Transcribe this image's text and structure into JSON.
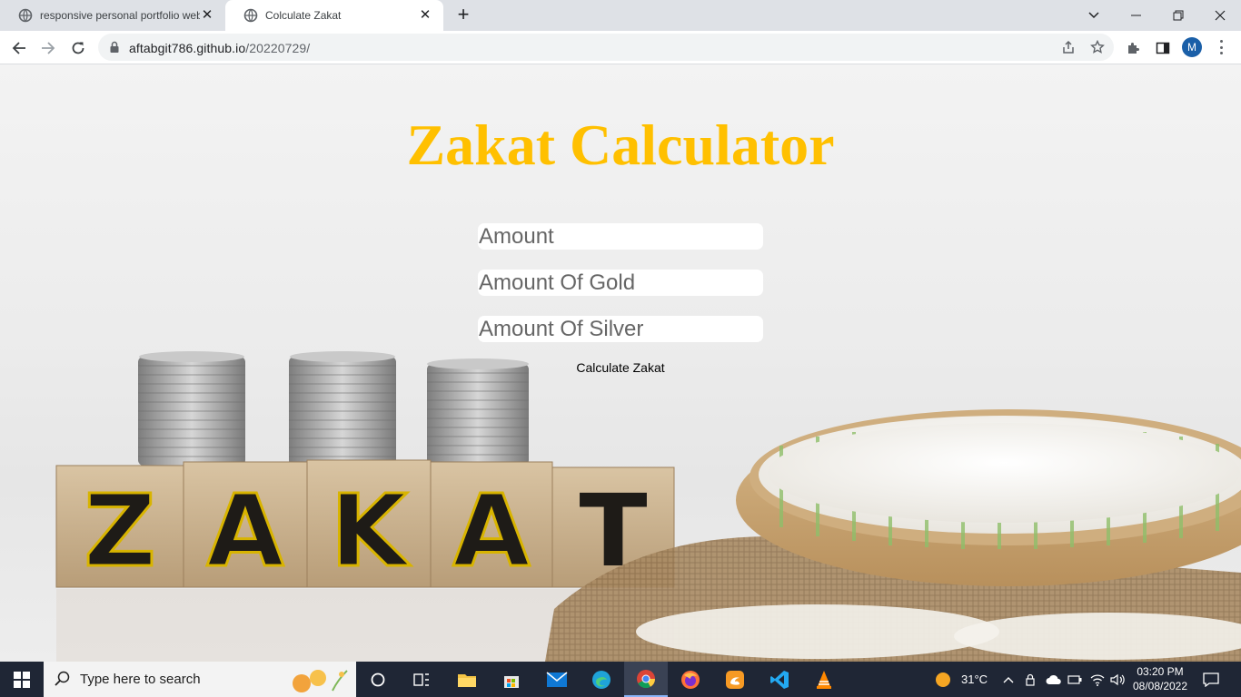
{
  "browser": {
    "tabs": [
      {
        "title": "responsive personal portfolio web",
        "active": false
      },
      {
        "title": "Colculate Zakat",
        "active": true
      }
    ],
    "url_host": "aftabgit786.github.io",
    "url_path": "/20220729/",
    "profile_initial": "M"
  },
  "page": {
    "title": "Zakat Calculator",
    "fields": [
      {
        "placeholder": "Amount"
      },
      {
        "placeholder": "Amount Of Gold"
      },
      {
        "placeholder": "Amount Of Silver"
      }
    ],
    "button_label": "Calculate Zakat",
    "image_letters": [
      "Z",
      "A",
      "K",
      "A",
      "T"
    ]
  },
  "taskbar": {
    "search_placeholder": "Type here to search",
    "weather": "31°C",
    "time": "03:20 PM",
    "date": "08/08/2022"
  },
  "colors": {
    "title": "#ffc000",
    "taskbar": "#1f2635",
    "avatar": "#1a5fa8"
  }
}
